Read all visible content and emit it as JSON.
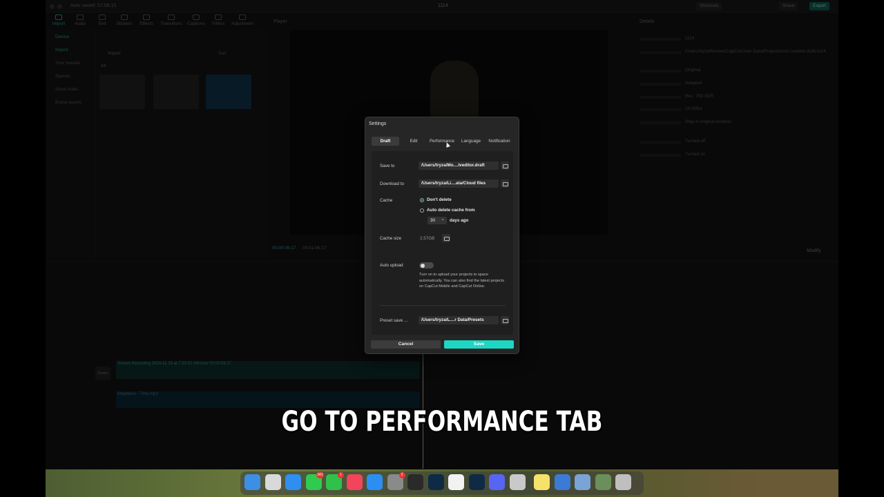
{
  "titlebar": {
    "autosave": "Auto saved: 07:58:15",
    "project_name": "1114",
    "shortcuts": "Shortcuts",
    "share": "Share",
    "export": "Export"
  },
  "toolbar": [
    "Import",
    "Audio",
    "Text",
    "Stickers",
    "Effects",
    "Transitions",
    "Captions",
    "Filters",
    "Adjustment"
  ],
  "media_panel": {
    "sidebar": [
      "Device",
      "Import",
      "Your presets",
      "Spaces",
      "Stock mate...",
      "Brand assets"
    ],
    "import_label": "Import",
    "filter_all": "All",
    "sort_label": "Sort"
  },
  "player": {
    "label": "Player",
    "timecode_current": "00:00:06:17",
    "timecode_total": "00:01:06:17"
  },
  "details": {
    "label": "Details",
    "rows": [
      {
        "value": "1114"
      },
      {
        "value": "/Users/tryza/Movies/CapCut/User Data/Projects/com.lveditor.draft/1114"
      },
      {
        "value": "Original"
      },
      {
        "value": "Adapted"
      },
      {
        "value": "Rec. 709 SDR"
      },
      {
        "value": "24.00fps"
      },
      {
        "value": "Stay in original location"
      },
      {
        "value": "Turned off"
      },
      {
        "value": "Turned on"
      }
    ],
    "modify": "Modify"
  },
  "timeline": {
    "clip_label": "Screen Recording 2024-11-19 at 7.53.52 AM.mov  00:03:06:17",
    "audio_label": "Mayplazio - Time.mp3",
    "cover": "Cover"
  },
  "settings": {
    "title": "Settings",
    "tabs": [
      {
        "label": "Draft",
        "active": true
      },
      {
        "label": "Edit",
        "active": false
      },
      {
        "label": "Performance",
        "active": false
      },
      {
        "label": "Language",
        "active": false
      },
      {
        "label": "Notification",
        "active": false
      }
    ],
    "save_to_label": "Save to",
    "save_to_path": "/Users/tryza/Mo....lveditor.draft",
    "download_label": "Download to",
    "download_path": "/Users/tryza/Li....ata/Cloud files",
    "cache_label": "Cache",
    "cache_option_1": "Don't delete",
    "cache_option_2": "Auto delete cache from",
    "cache_selected": "Don't delete",
    "days_value": "30",
    "days_suffix": "days ago",
    "cache_size_label": "Cache size",
    "cache_size_value": "2.57GB",
    "auto_upload_label": "Auto upload",
    "auto_upload_on": false,
    "auto_upload_help": "Turn on to upload your projects to space automatically. You can also find the latest projects on CapCut Mobile and CapCut Online.",
    "preset_label": "Preset save ...",
    "preset_path": "/Users/tryza/L....r Data/Presets",
    "cancel": "Cancel",
    "save": "Save",
    "accent_color": "#1ed6c4"
  },
  "caption": "GO TO PERFORMANCE TAB",
  "dock": {
    "icons": [
      {
        "name": "finder-icon",
        "color": "#3b8fe6"
      },
      {
        "name": "launchpad-icon",
        "color": "#d9d9d9"
      },
      {
        "name": "safari-icon",
        "color": "#2f8ef0"
      },
      {
        "name": "messages-icon",
        "color": "#2fcb4f",
        "badge": "343"
      },
      {
        "name": "facetime-icon",
        "color": "#2fc14a",
        "badge": "1"
      },
      {
        "name": "music-icon",
        "color": "#f2445a"
      },
      {
        "name": "app-store-icon",
        "color": "#2b8ef2"
      },
      {
        "name": "system-settings-icon",
        "color": "#8a8a8a",
        "badge": "2"
      },
      {
        "name": "final-cut-icon",
        "color": "#2a2a2a"
      },
      {
        "name": "lightroom-classic-icon",
        "color": "#0f2a45"
      },
      {
        "name": "capcut-icon",
        "color": "#f2f2f2"
      },
      {
        "name": "photoshop-icon",
        "color": "#0f2a45"
      },
      {
        "name": "discord-icon",
        "color": "#5865f2"
      },
      {
        "name": "tool-icon",
        "color": "#c9c9c9"
      },
      {
        "name": "notes-icon",
        "color": "#f6e26a"
      },
      {
        "name": "quicktime-icon",
        "color": "#3a7bd5"
      },
      {
        "name": "preview-icon",
        "color": "#7aa3d6"
      },
      {
        "name": "photo-file-icon",
        "color": "#6b8f5a"
      },
      {
        "name": "trash-icon",
        "color": "#bfbfbf"
      }
    ]
  }
}
